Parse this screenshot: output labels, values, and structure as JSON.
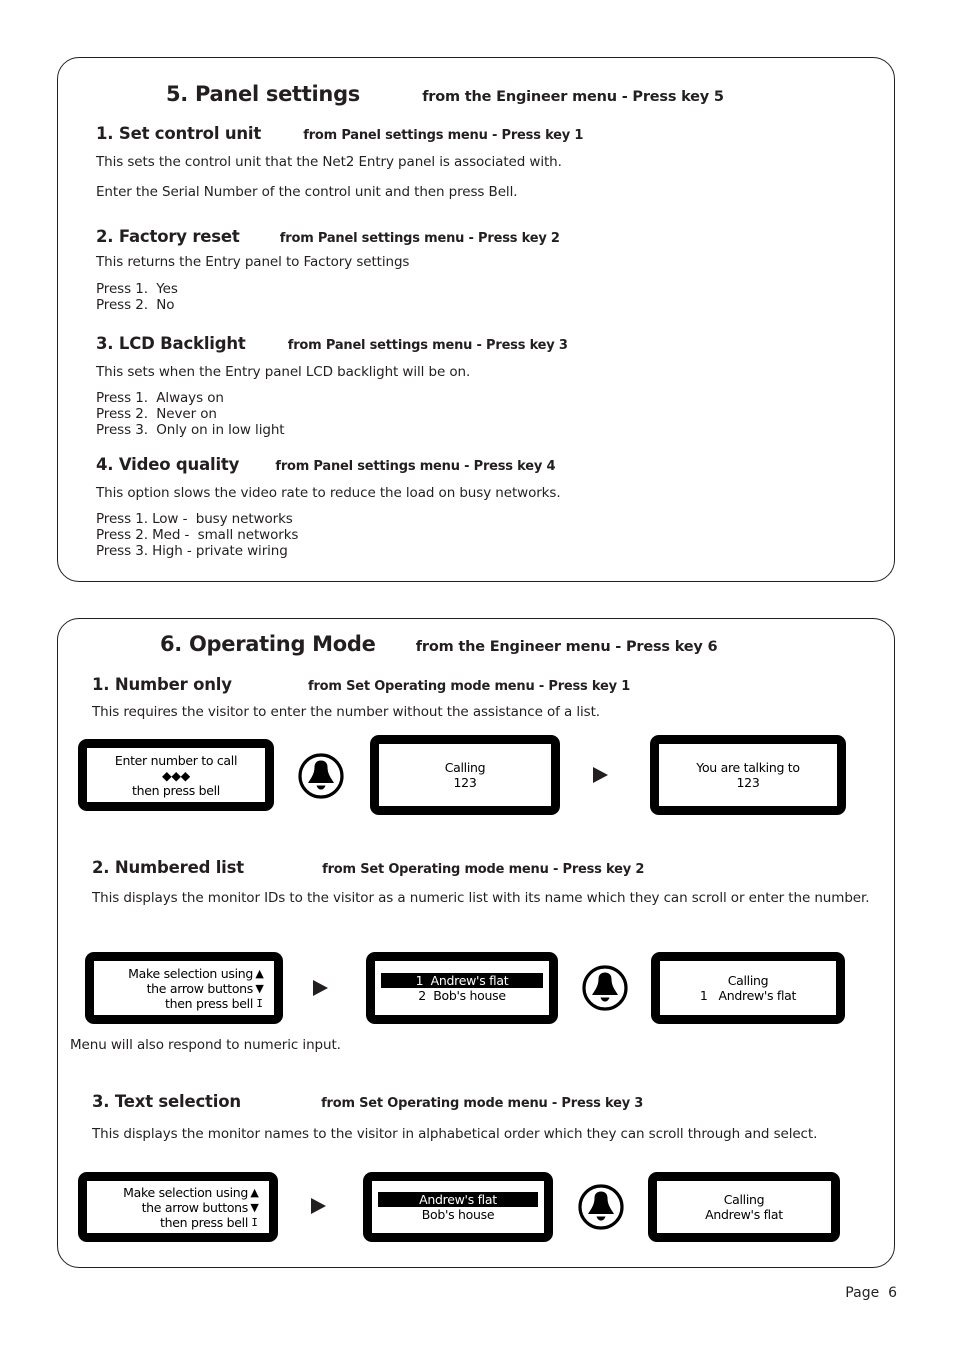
{
  "page": {
    "footer": "Page  6"
  },
  "sections": [
    {
      "title": "5. Panel settings",
      "from": "from the Engineer menu - Press key 5",
      "subsections": [
        {
          "title": "1. Set control unit",
          "from": "from Panel settings menu - Press key 1",
          "body1": "This sets the control unit that the Net2 Entry panel is associated with.",
          "body2": "Enter the Serial Number of the control unit and then press Bell."
        },
        {
          "title": "2. Factory reset",
          "from": "from Panel settings menu - Press key 2",
          "body1": "This returns the Entry panel to Factory settings",
          "options": "Press 1.  Yes\nPress 2.  No"
        },
        {
          "title": "3. LCD Backlight",
          "from": "from Panel settings menu - Press key 3",
          "body1": "This sets when the Entry panel LCD backlight will be on.",
          "options": "Press 1.  Always on\nPress 2.  Never on\nPress 3.  Only on in low light"
        },
        {
          "title": "4. Video quality",
          "from": "from Panel settings menu - Press key 4",
          "body1": "This option slows the video rate to reduce the load on busy networks.",
          "options": "Press 1. Low -  busy networks\nPress 2. Med -  small networks\nPress 3. High - private wiring"
        }
      ]
    },
    {
      "title": "6. Operating Mode",
      "from": "from the Engineer menu - Press key 6",
      "subsections": [
        {
          "title": "1. Number only",
          "from": "from Set Operating mode menu - Press key 1",
          "body1": "This requires the visitor to enter the number without the assistance of a list."
        },
        {
          "title": "2. Numbered list",
          "from": "from Set Operating mode menu - Press key 2",
          "body1": "This displays the monitor IDs to the visitor as a numeric list with its name which they can scroll or enter the number.",
          "note": "Menu will also respond to numeric input."
        },
        {
          "title": "3. Text selection",
          "from": "from Set Operating mode menu - Press key 3",
          "body1": "This displays the monitor names to the visitor in alphabetical order which they can scroll through and select."
        }
      ]
    }
  ],
  "flows": {
    "number_only": {
      "lcd1": {
        "line1": "Enter number to call",
        "line2": "◆◆◆",
        "line3": "then press bell"
      },
      "lcd2": {
        "line1": "Calling",
        "line2": "123"
      },
      "lcd3": {
        "line1": "You are talking to",
        "line2": "123"
      }
    },
    "numbered_list": {
      "lcd1": {
        "line1": "Make selection using",
        "arrow1": "▲",
        "line2": "the arrow buttons",
        "arrow2": "▼",
        "line3": "then press bell",
        "arrow3": "ⵊ"
      },
      "lcd2": {
        "line1": "1  Andrew's flat",
        "line2": "2  Bob's house"
      },
      "lcd3": {
        "line1": "Calling",
        "line2": "1   Andrew's flat"
      }
    },
    "text_selection": {
      "lcd1": {
        "line1": "Make selection using",
        "arrow1": "▲",
        "line2": "the arrow buttons",
        "arrow2": "▼",
        "line3": "then press bell",
        "arrow3": "ⵊ"
      },
      "lcd2": {
        "line1": "Andrew's flat",
        "line2": "Bob's house"
      },
      "lcd3": {
        "line1": "Calling",
        "line2": "Andrew's flat"
      }
    }
  },
  "icons": {
    "bell": "bell-icon",
    "flow_arrow": "right-arrow-icon"
  },
  "colors": {
    "text": "#231f20",
    "lcd_bezel": "#000000",
    "lcd_screen": "#ffffff"
  }
}
